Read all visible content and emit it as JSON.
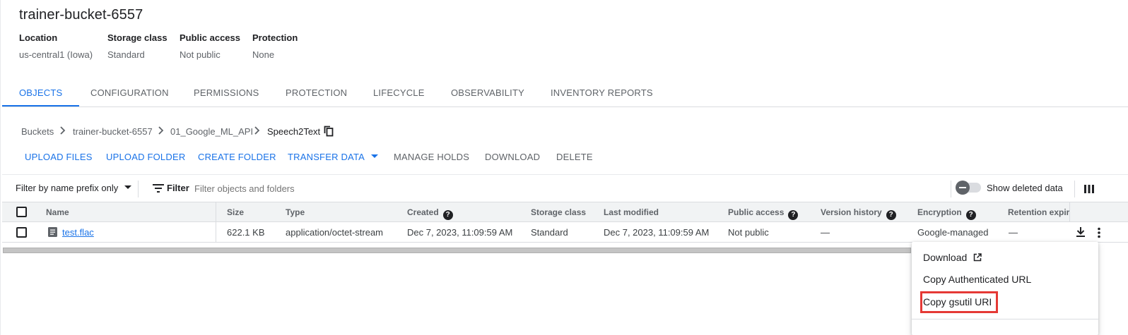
{
  "bucket": {
    "title": "trainer-bucket-6557",
    "meta": [
      {
        "label": "Location",
        "value": "us-central1 (Iowa)"
      },
      {
        "label": "Storage class",
        "value": "Standard"
      },
      {
        "label": "Public access",
        "value": "Not public"
      },
      {
        "label": "Protection",
        "value": "None"
      }
    ]
  },
  "tabs": [
    "OBJECTS",
    "CONFIGURATION",
    "PERMISSIONS",
    "PROTECTION",
    "LIFECYCLE",
    "OBSERVABILITY",
    "INVENTORY REPORTS"
  ],
  "active_tab": "OBJECTS",
  "breadcrumb": [
    "Buckets",
    "trainer-bucket-6557",
    "01_Google_ML_API",
    "Speech2Text"
  ],
  "actions": {
    "upload_files": "UPLOAD FILES",
    "upload_folder": "UPLOAD FOLDER",
    "create_folder": "CREATE FOLDER",
    "transfer_data": "TRANSFER DATA",
    "manage_holds": "MANAGE HOLDS",
    "download": "DOWNLOAD",
    "delete": "DELETE"
  },
  "filterbar": {
    "prefix_select": "Filter by name prefix only",
    "filter_label": "Filter",
    "filter_placeholder": "Filter objects and folders",
    "show_deleted": "Show deleted data"
  },
  "table": {
    "columns": [
      "Name",
      "Size",
      "Type",
      "Created",
      "Storage class",
      "Last modified",
      "Public access",
      "Version history",
      "Encryption",
      "Retention expira"
    ],
    "rows": [
      {
        "name": "test.flac",
        "size": "622.1 KB",
        "type": "application/octet-stream",
        "created": "Dec 7, 2023, 11:09:59 AM",
        "storage_class": "Standard",
        "last_modified": "Dec 7, 2023, 11:09:59 AM",
        "public_access": "Not public",
        "version_history": "—",
        "encryption": "Google-managed",
        "retention": "—"
      }
    ]
  },
  "context_menu": {
    "items": [
      "Download",
      "Copy Authenticated URL",
      "Copy gsutil URI"
    ],
    "highlighted": "Copy gsutil URI"
  },
  "colors": {
    "accent": "#1a73e8",
    "highlight": "#e53935",
    "header_bg": "#f1f3f4"
  }
}
